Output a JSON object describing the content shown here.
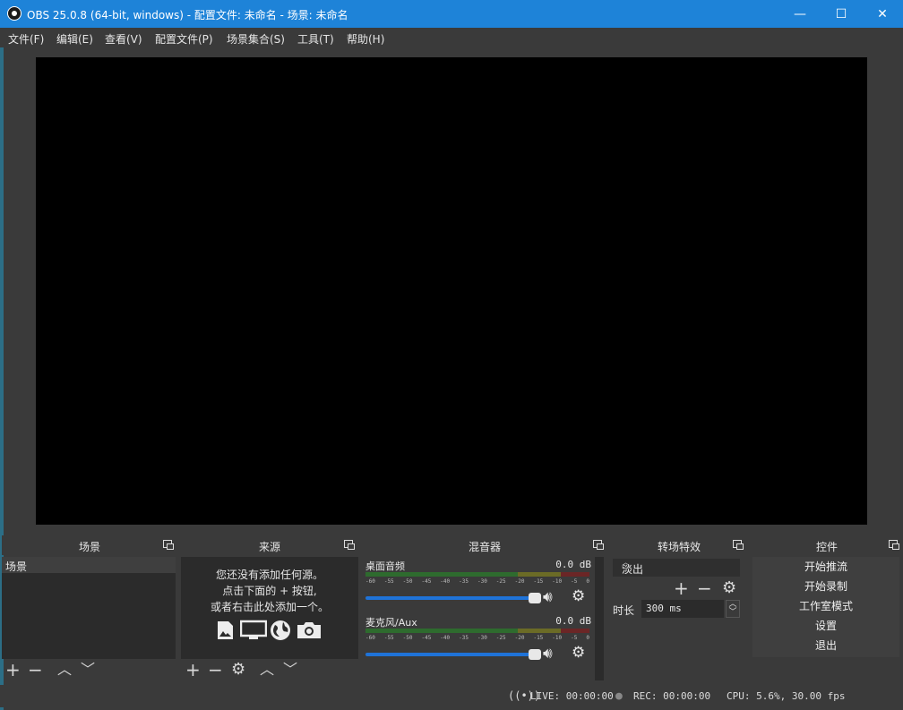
{
  "window": {
    "title": "OBS 25.0.8 (64-bit, windows) - 配置文件: 未命名 - 场景: 未命名",
    "minimize": "—",
    "maximize": "☐",
    "close": "✕"
  },
  "menu": [
    "文件(F)",
    "编辑(E)",
    "查看(V)",
    "配置文件(P)",
    "场景集合(S)",
    "工具(T)",
    "帮助(H)"
  ],
  "docks": {
    "scenes": {
      "title": "场景",
      "items": [
        "场景"
      ]
    },
    "sources": {
      "title": "来源",
      "empty_lines": [
        "您还没有添加任何源。",
        "点击下面的 + 按钮,",
        "或者右击此处添加一个。"
      ]
    },
    "mixer": {
      "title": "混音器",
      "channels": [
        {
          "name": "桌面音频",
          "db": "0.0 dB"
        },
        {
          "name": "麦克风/Aux",
          "db": "0.0 dB"
        }
      ],
      "scale": [
        "-60",
        "-55",
        "-50",
        "-45",
        "-40",
        "-35",
        "-30",
        "-25",
        "-20",
        "-15",
        "-10",
        "-5",
        "0"
      ]
    },
    "transitions": {
      "title": "转场特效",
      "selected": "淡出",
      "duration_label": "时长",
      "duration_value": "300 ms"
    },
    "controls": {
      "title": "控件",
      "buttons": [
        "开始推流",
        "开始录制",
        "工作室模式",
        "设置",
        "退出"
      ]
    }
  },
  "status": {
    "live": "LIVE: 00:00:00",
    "rec": "REC: 00:00:00",
    "cpu": "CPU: 5.6%, 30.00 fps"
  },
  "colors": {
    "titlebar": "#1e83d8",
    "background": "#3a3a3a",
    "preview": "#000000",
    "slider": "#1f73d8"
  }
}
